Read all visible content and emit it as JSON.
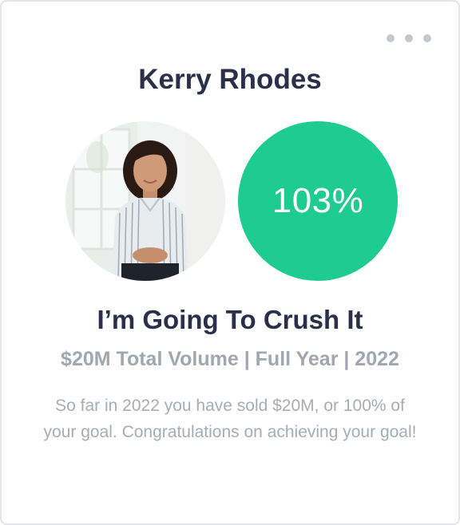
{
  "card": {
    "name": "Kerry Rhodes",
    "progress": {
      "value_text": "103%",
      "percent": 103,
      "color": "#1ecb91"
    },
    "goal_title": "I’m Going To Crush It",
    "goal_subtitle": "$20M Total Volume | Full Year | 2022",
    "message": "So far in 2022 you have sold $20M, or 100% of your goal. Congratulations on achieving your goal!"
  },
  "icons": {
    "menu": "more-horizontal-icon"
  }
}
